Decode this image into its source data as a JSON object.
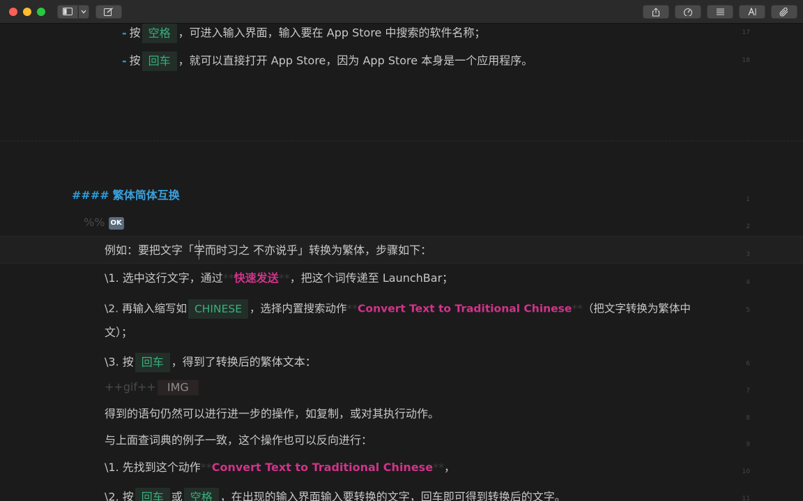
{
  "toolbar": {
    "buttons": {
      "sidebar_icon": "sidebar-icon",
      "chevron_icon": "chevron-down-icon",
      "compose_icon": "compose-icon",
      "share_icon": "share-icon",
      "speedometer_icon": "speedometer-icon",
      "list_icon": "list-icon",
      "typography_icon": "typography-icon",
      "attachment_icon": "paperclip-icon"
    }
  },
  "lines": {
    "l17": {
      "ln": "17",
      "dash": "-",
      "t1": "按",
      "code": "空格",
      "t2": "，可进入输入界面，输入要在 App Store 中搜索的软件名称；"
    },
    "l18": {
      "ln": "18",
      "dash": "-",
      "t1": "按",
      "code": "回车",
      "t2": "，就可以直接打开 App Store，因为 App Store 本身是一个应用程序。"
    },
    "h1": {
      "ln": "1",
      "hash": "####",
      "text": "繁体简体互换"
    },
    "l2": {
      "ln": "2",
      "prefix": "%%",
      "badge": "OK"
    },
    "l3": {
      "ln": "3",
      "text": "例如：要把文字「学而时习之 不亦说乎」转换为繁体，步骤如下："
    },
    "l4": {
      "ln": "4",
      "t1": "\\1. 选中这行文字，通过",
      "mark_open": "**",
      "strong": "快速发送",
      "mark_close": "**",
      "t2": "，把这个词传递至 LaunchBar；"
    },
    "l5": {
      "ln": "5",
      "t1": "\\2. 再输入缩写如",
      "code": "CHINESE",
      "t2": "，选择内置搜索动作",
      "mark_open": "**",
      "strong": "Convert Text to Traditional Chinese",
      "mark_close": "**",
      "t3": "（把文字转换为繁体中",
      "wrap": "文）；"
    },
    "l6": {
      "ln": "6",
      "t1": "\\3. 按",
      "code": "回车",
      "t2": "，得到了转换后的繁体文本："
    },
    "l7": {
      "ln": "7",
      "prefix": "++gif++",
      "img": "IMG"
    },
    "l8": {
      "ln": "8",
      "text": "得到的语句仍然可以进行进一步的操作，如复制，或对其执行动作。"
    },
    "l9": {
      "ln": "9",
      "text": "与上面查词典的例子一致，这个操作也可以反向进行："
    },
    "l10": {
      "ln": "10",
      "t1": "\\1. 先找到这个动作",
      "mark_open": "**",
      "strong": "Convert Text to Traditional Chinese",
      "mark_close": "**",
      "t2": "，"
    },
    "l11": {
      "ln": "11",
      "t1": "\\2. 按",
      "code1": "回车",
      "t2": "或",
      "code2": "空格",
      "t3": "，在出现的输入界面输入要转换的文字，回车即可得到转换后的文字。"
    }
  },
  "colors": {
    "background": "#1b1b1b",
    "text": "#c8c8c8",
    "code": "#39b07c",
    "strong": "#d0338a",
    "heading": "#3aa0dc"
  }
}
